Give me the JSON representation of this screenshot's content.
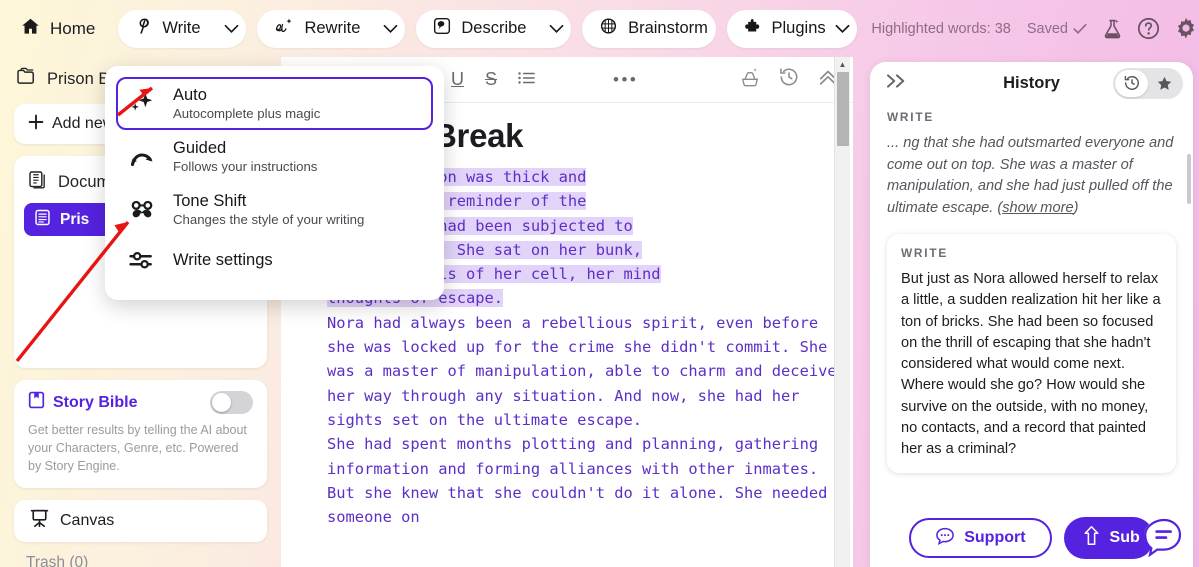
{
  "topbar": {
    "home_label": "Home",
    "tools": [
      {
        "label": "Write",
        "icon": "quill-icon",
        "has_caret": true
      },
      {
        "label": "Rewrite",
        "icon": "ai-cursive-icon",
        "has_caret": true
      },
      {
        "label": "Describe",
        "icon": "describe-frame-icon",
        "has_caret": true
      },
      {
        "label": "Brainstorm",
        "icon": "brain-icon",
        "has_caret": false
      },
      {
        "label": "Plugins",
        "icon": "puzzle-icon",
        "has_caret": true
      }
    ],
    "highlighted_words": "Highlighted words: 38",
    "saved_label": "Saved",
    "icons": [
      "flask-icon",
      "help-circle-icon",
      "gear-icon"
    ]
  },
  "write_menu": {
    "items": [
      {
        "title": "Auto",
        "subtitle": "Autocomplete plus magic",
        "icon": "sparkle-icon",
        "selected": true
      },
      {
        "title": "Guided",
        "subtitle": "Follows your instructions",
        "icon": "fork-arrows-icon",
        "selected": false
      },
      {
        "title": "Tone Shift",
        "subtitle": "Changes the style of your writing",
        "icon": "mustache-glasses-icon",
        "selected": false
      },
      {
        "title": "Write settings",
        "subtitle": "",
        "icon": "sliders-icon",
        "selected": false
      }
    ]
  },
  "sidebar": {
    "project_name": "Prison B",
    "project_icon": "folder-icon",
    "add_new_label": "Add new",
    "documents_label": "Docum",
    "documents_icon": "documents-icon",
    "active_document": "Pris",
    "story_bible": {
      "title": "Story Bible",
      "icon": "book-icon",
      "description": "Get better results by telling the AI about your Characters, Genre, etc. Powered by Story Engine.",
      "toggle_on": false
    },
    "canvas_label": "Canvas",
    "canvas_icon": "easel-icon",
    "trash_label": "Trash (0)"
  },
  "editor": {
    "format_tools": [
      "U",
      "S",
      "list-icon"
    ],
    "more_label": "•••",
    "right_icons": [
      "sparkle-tray-icon",
      "history-clock-icon",
      "collapse-up-icon"
    ],
    "doc_title": "Break",
    "paragraphs": [
      {
        "text": "ide the prison was thick and\n, a constant reminder of the\nt that Nora had been subjected to\nt five years. She sat on her bunk,\nthe grey walls of her cell, her mind\nthoughts of escape.",
        "highlighted": true
      },
      {
        "text": "Nora had always been a rebellious spirit, even before she was locked up for the crime she didn't commit. She was a master of manipulation, able to charm and deceive her way through any situation. And now, she had her sights set on the ultimate escape.",
        "highlighted": false
      },
      {
        "text": "She had spent months plotting and planning, gathering information and forming alliances with other inmates. But she knew that she couldn't do it alone. She needed someone on",
        "highlighted": false
      }
    ]
  },
  "history": {
    "title": "History",
    "collapse_icon": "chevron-double-right-icon",
    "tabs": [
      {
        "icon": "history-clock-icon",
        "active": true
      },
      {
        "icon": "star-icon",
        "active": false
      }
    ],
    "entries": [
      {
        "kicker": "WRITE",
        "text": "... ng that she had outsmarted everyone and come out on top. She was a master of manipulation, and she had just pulled off the ultimate escape. (",
        "show_more": "show more",
        "tail": ")",
        "card": false
      },
      {
        "kicker": "WRITE",
        "text": "But just as Nora allowed herself to relax a little, a sudden realization hit her like a ton of bricks. She had been so focused on the thrill of escaping that she hadn't considered what would come next. Where would she go? How would she survive on the outside, with no money, no contacts, and a record that painted her as a criminal?",
        "card": true
      }
    ],
    "support_label": "Support",
    "support_icon": "chat-bubble-icon",
    "sub_label": "Sub",
    "sub_icon": "arrow-up-icon",
    "helper_icon": "assistant-bubble-icon"
  },
  "colors": {
    "accent": "#5522e0",
    "highlight_bg": "#e2d3f8",
    "doc_text": "#5c2fc7",
    "annotation": "#e81414"
  }
}
